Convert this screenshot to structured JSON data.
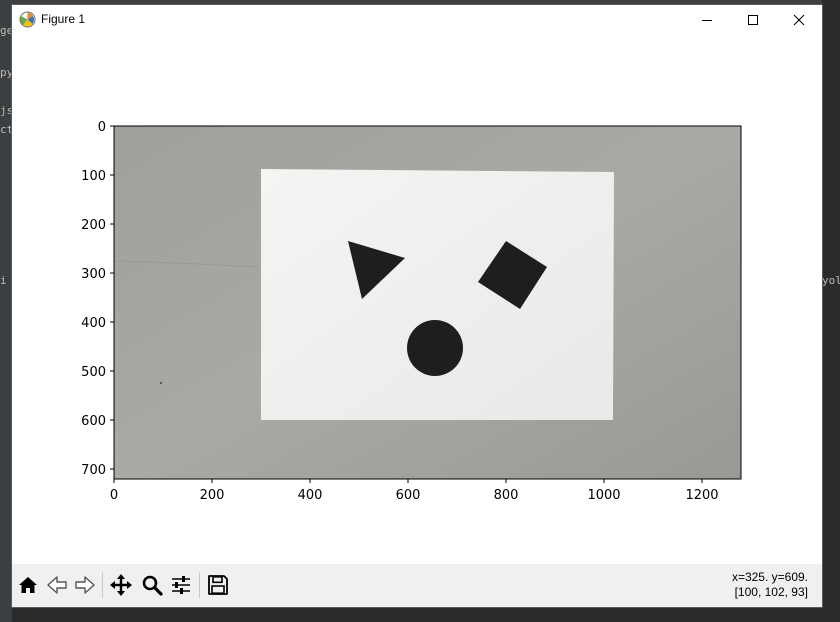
{
  "window": {
    "title": "Figure 1"
  },
  "background_ide": {
    "left_hints": [
      "ge",
      "py",
      "js",
      "ct.",
      "i"
    ],
    "right_hints": [
      "yol"
    ]
  },
  "plot": {
    "x_ticks": [
      "0",
      "200",
      "400",
      "600",
      "800",
      "1000",
      "1200"
    ],
    "y_ticks": [
      "0",
      "100",
      "200",
      "300",
      "400",
      "500",
      "600",
      "700"
    ]
  },
  "chart_data": {
    "type": "image",
    "title": "",
    "xlabel": "",
    "ylabel": "",
    "xlim": [
      0,
      1280
    ],
    "ylim": [
      720,
      0
    ],
    "image_size": [
      1280,
      720
    ],
    "content": "photo of a sheet of paper on a wall with a dark triangle, a dark square and a dark circle"
  },
  "toolbar": {
    "buttons": [
      "home-icon",
      "back-icon",
      "forward-icon",
      "pan-icon",
      "zoom-icon",
      "configure-subplots-icon",
      "save-icon"
    ],
    "coords_line1": "x=325. y=609.",
    "coords_line2": "[100, 102, 93]"
  },
  "colors": {
    "wall": "#a3a59f",
    "paper": "#f2f2f2",
    "shape": "#1e1f1c",
    "toolbar_bg": "#f0f0f0"
  }
}
